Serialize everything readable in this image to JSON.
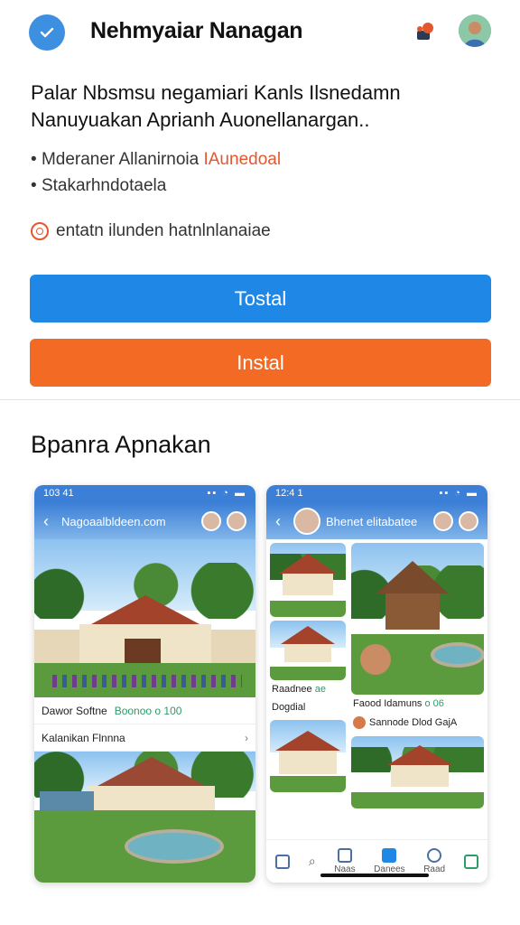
{
  "header": {
    "title": "Nehmyaiar Nanagan",
    "check_icon": "check-circle-icon",
    "puzzle_icon": "puzzle-icon",
    "avatar": "user-avatar"
  },
  "intro": {
    "headline_line1": "Palar Nbsmsu negamiari Kanls Ilsnedamn",
    "headline_line2": "Nanuyuakan Aprianh Auonellanargan..",
    "bullets": [
      {
        "text": "Mderaner Allanirnoia ",
        "highlight": "IAunedoal"
      },
      {
        "text": "Stakarhndotaela",
        "highlight": ""
      }
    ],
    "note": "entatn ilunden hatnlnlanaiae"
  },
  "buttons": {
    "primary_label": "Tostal",
    "secondary_label": "Instal"
  },
  "section": {
    "title": "Bpanra Apnakan"
  },
  "screenshot_left": {
    "time": "103 41",
    "appbar_title": "Nagoaalbldeen.com",
    "row1_label": "Dawor Softne",
    "row1_accent": "Boonoo o 100",
    "row2_label": "Kalanikan Flnnna"
  },
  "screenshot_right": {
    "time": "12:4 1",
    "appbar_title": "Bhenet elitabatee",
    "left_label": "Raadnee",
    "left_accent": "ae",
    "left_label2": "Dogdial",
    "right_label": "Faood Idamuns",
    "right_accent": "o 06",
    "right_row2": "Sannode Dlod GajA",
    "tab_labels": [
      "",
      "",
      "Naas",
      "Danees",
      "Raad",
      ""
    ]
  },
  "colors": {
    "primary_button": "#1f87e6",
    "secondary_button": "#f36a24",
    "highlight_text": "#e4572e"
  }
}
